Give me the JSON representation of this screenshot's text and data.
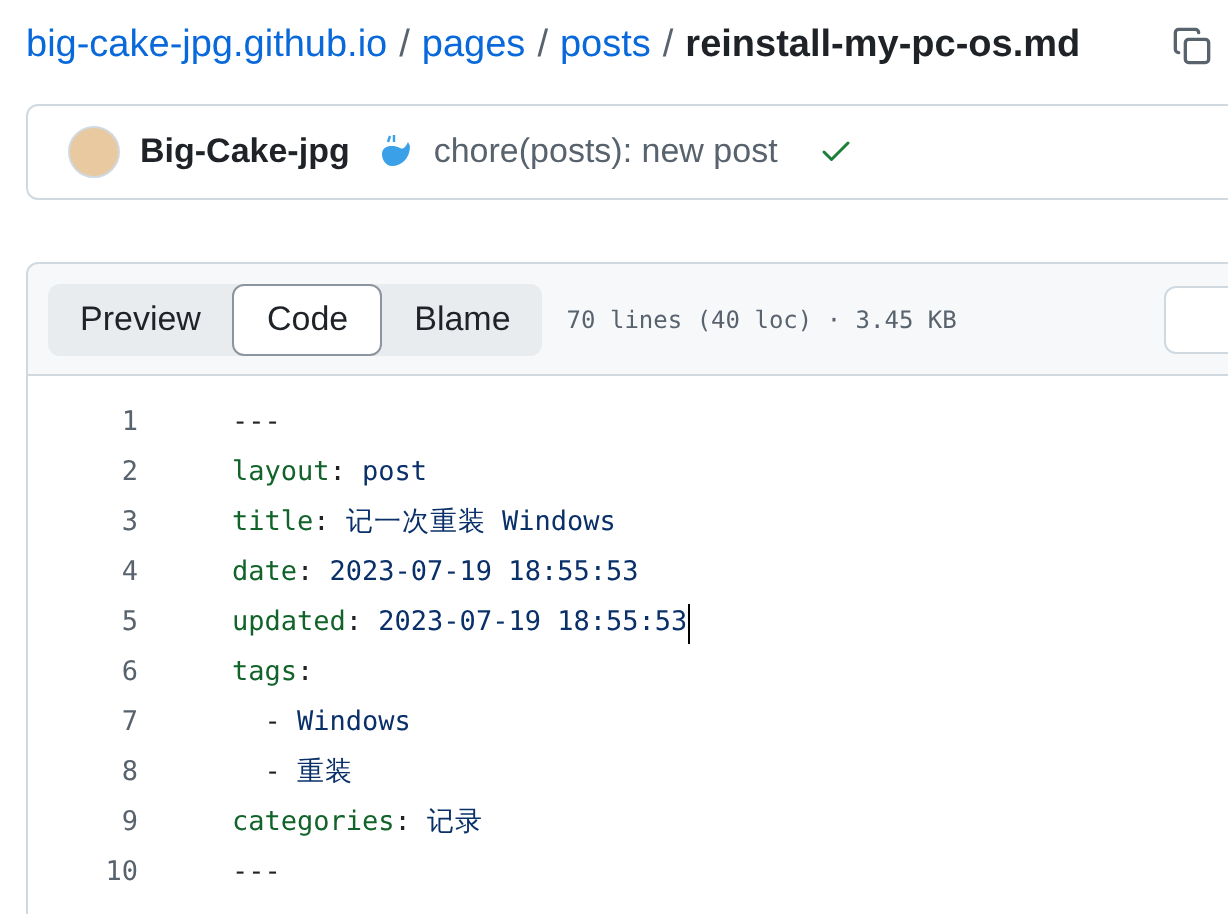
{
  "breadcrumb": {
    "repo": "big-cake-jpg.github.io",
    "folders": [
      "pages",
      "posts"
    ],
    "separator": "/",
    "file": "reinstall-my-pc-os.md"
  },
  "commit": {
    "author": "Big-Cake-jpg",
    "message": "chore(posts): new post",
    "checks_passed": true
  },
  "view_tabs": [
    {
      "label": "Preview",
      "selected": false
    },
    {
      "label": "Code",
      "selected": true
    },
    {
      "label": "Blame",
      "selected": false
    }
  ],
  "file_info": "70 lines (40 loc) · 3.45 KB",
  "code_lines": [
    {
      "number": "1",
      "cursor": false,
      "parts": [
        {
          "kind": "plain",
          "text": "---"
        }
      ]
    },
    {
      "number": "2",
      "cursor": false,
      "parts": [
        {
          "kind": "key",
          "text": "layout"
        },
        {
          "kind": "plain",
          "text": ": "
        },
        {
          "kind": "value",
          "text": "post"
        }
      ]
    },
    {
      "number": "3",
      "cursor": false,
      "parts": [
        {
          "kind": "key",
          "text": "title"
        },
        {
          "kind": "plain",
          "text": ": "
        },
        {
          "kind": "value",
          "text": "记一次重装 Windows"
        }
      ]
    },
    {
      "number": "4",
      "cursor": false,
      "parts": [
        {
          "kind": "key",
          "text": "date"
        },
        {
          "kind": "plain",
          "text": ": "
        },
        {
          "kind": "value",
          "text": "2023-07-19 18:55:53"
        }
      ]
    },
    {
      "number": "5",
      "cursor": true,
      "parts": [
        {
          "kind": "key",
          "text": "updated"
        },
        {
          "kind": "plain",
          "text": ": "
        },
        {
          "kind": "value",
          "text": "2023-07-19 18:55:53"
        }
      ]
    },
    {
      "number": "6",
      "cursor": false,
      "parts": [
        {
          "kind": "key",
          "text": "tags"
        },
        {
          "kind": "plain",
          "text": ":"
        }
      ]
    },
    {
      "number": "7",
      "cursor": false,
      "parts": [
        {
          "kind": "plain",
          "text": "  - "
        },
        {
          "kind": "value",
          "text": "Windows"
        }
      ]
    },
    {
      "number": "8",
      "cursor": false,
      "parts": [
        {
          "kind": "plain",
          "text": "  - "
        },
        {
          "kind": "value",
          "text": "重装"
        }
      ]
    },
    {
      "number": "9",
      "cursor": false,
      "parts": [
        {
          "kind": "key",
          "text": "categories"
        },
        {
          "kind": "plain",
          "text": ": "
        },
        {
          "kind": "value",
          "text": "记录"
        }
      ]
    },
    {
      "number": "10",
      "cursor": false,
      "parts": [
        {
          "kind": "plain",
          "text": "---"
        }
      ]
    }
  ]
}
